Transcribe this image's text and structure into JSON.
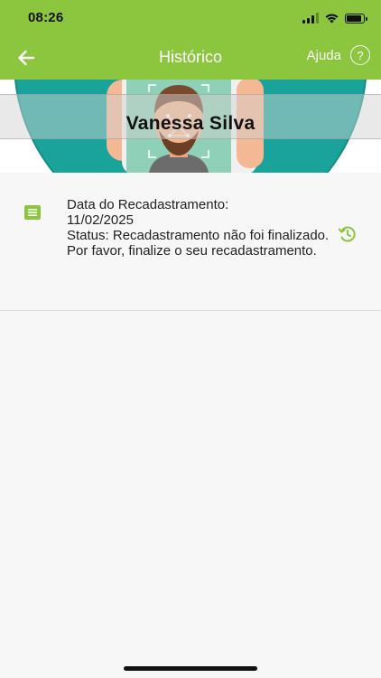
{
  "status_bar": {
    "time": "08:26",
    "icons": [
      "signal-icon",
      "wifi-icon",
      "battery-icon"
    ]
  },
  "nav": {
    "title": "Histórico",
    "help_label": "Ajuda",
    "help_icon_glyph": "?",
    "back_icon": "arrow-left-icon",
    "background_color": "#8cc63f"
  },
  "banner": {
    "name": "Vanessa Silva",
    "illustration": "face-recognition-illustration"
  },
  "record": {
    "date_label": "Data do Recadastramento:",
    "date_value": "11/02/2025",
    "status_text": "Status: Recadastramento não foi finalizado. Por favor, finalize o seu recadastramento.",
    "icon": "document-icon",
    "action_icon": "history-icon",
    "accent_color": "#8cc63f"
  }
}
